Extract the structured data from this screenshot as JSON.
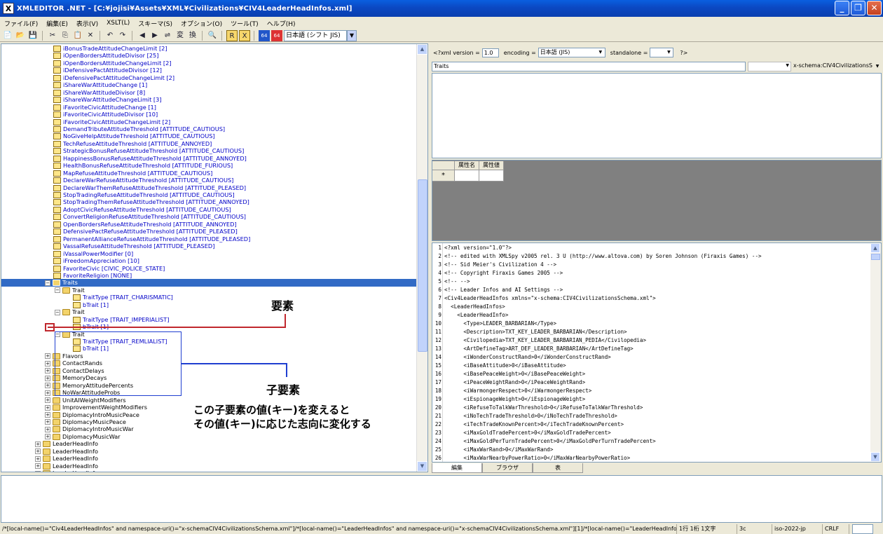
{
  "window": {
    "app_icon": "X",
    "title": "XMLEDITOR .NET - [C:¥jojisi¥Assets¥XML¥Civilizations¥CIV4LeaderHeadInfos.xml]",
    "minimize_glyph": "_",
    "maximize_glyph": "❐",
    "close_glyph": "✕"
  },
  "menu": {
    "items": [
      "ファイル(F)",
      "編集(E)",
      "表示(V)",
      "XSLT(L)",
      "スキーマ(S)",
      "オプション(O)",
      "ツール(T)",
      "ヘルプ(H)"
    ]
  },
  "toolbar": {
    "icons": [
      "new-file",
      "open-folder",
      "save",
      "cut",
      "copy",
      "paste",
      "delete",
      "undo",
      "redo",
      "find-prev",
      "find-next",
      "replace",
      "convert",
      "transform",
      "binoculars",
      "r-tool",
      "x-tool",
      "encode-64",
      "decode-64"
    ],
    "glyphs": [
      "📄",
      "📂",
      "💾",
      "✂",
      "⎘",
      "📋",
      "✕",
      "↶",
      "↷",
      "◀",
      "▶",
      "⇌",
      "変",
      "換",
      "🔍",
      "R",
      "X",
      "64",
      "64"
    ],
    "language_label": "日本語 (シフト JIS)",
    "dropdown_glyph": "▼"
  },
  "tree": {
    "rows": [
      {
        "text": "iBonusTradeAttitudeChangeLimit  [2]",
        "type": "leaf"
      },
      {
        "text": "iOpenBordersAttitudeDivisor  [25]",
        "type": "leaf"
      },
      {
        "text": "iOpenBordersAttitudeChangeLimit  [2]",
        "type": "leaf"
      },
      {
        "text": "iDefensivePactAttitudeDivisor  [12]",
        "type": "leaf"
      },
      {
        "text": "iDefensivePactAttitudeChangeLimit  [2]",
        "type": "leaf"
      },
      {
        "text": "iShareWarAttitudeChange  [1]",
        "type": "leaf"
      },
      {
        "text": "iShareWarAttitudeDivisor  [8]",
        "type": "leaf"
      },
      {
        "text": "iShareWarAttitudeChangeLimit  [3]",
        "type": "leaf"
      },
      {
        "text": "iFavoriteCivicAttitudeChange  [1]",
        "type": "leaf"
      },
      {
        "text": "iFavoriteCivicAttitudeDivisor  [10]",
        "type": "leaf"
      },
      {
        "text": "iFavoriteCivicAttitudeChangeLimit  [2]",
        "type": "leaf"
      },
      {
        "text": "DemandTributeAttitudeThreshold  [ATTITUDE_CAUTIOUS]",
        "type": "leaf"
      },
      {
        "text": "NoGiveHelpAttitudeThreshold  [ATTITUDE_CAUTIOUS]",
        "type": "leaf"
      },
      {
        "text": "TechRefuseAttitudeThreshold  [ATTITUDE_ANNOYED]",
        "type": "leaf"
      },
      {
        "text": "StrategicBonusRefuseAttitudeThreshold  [ATTITUDE_CAUTIOUS]",
        "type": "leaf"
      },
      {
        "text": "HappinessBonusRefuseAttitudeThreshold  [ATTITUDE_ANNOYED]",
        "type": "leaf"
      },
      {
        "text": "HealthBonusRefuseAttitudeThreshold  [ATTITUDE_FURIOUS]",
        "type": "leaf"
      },
      {
        "text": "MapRefuseAttitudeThreshold  [ATTITUDE_CAUTIOUS]",
        "type": "leaf"
      },
      {
        "text": "DeclareWarRefuseAttitudeThreshold  [ATTITUDE_CAUTIOUS]",
        "type": "leaf"
      },
      {
        "text": "DeclareWarThemRefuseAttitudeThreshold  [ATTITUDE_PLEASED]",
        "type": "leaf"
      },
      {
        "text": "StopTradingRefuseAttitudeThreshold  [ATTITUDE_CAUTIOUS]",
        "type": "leaf"
      },
      {
        "text": "StopTradingThemRefuseAttitudeThreshold  [ATTITUDE_ANNOYED]",
        "type": "leaf"
      },
      {
        "text": "AdoptCivicRefuseAttitudeThreshold  [ATTITUDE_CAUTIOUS]",
        "type": "leaf"
      },
      {
        "text": "ConvertReligionRefuseAttitudeThreshold  [ATTITUDE_CAUTIOUS]",
        "type": "leaf"
      },
      {
        "text": "OpenBordersRefuseAttitudeThreshold  [ATTITUDE_ANNOYED]",
        "type": "leaf"
      },
      {
        "text": "DefensivePactRefuseAttitudeThreshold  [ATTITUDE_PLEASED]",
        "type": "leaf"
      },
      {
        "text": "PermanentAllianceRefuseAttitudeThreshold  [ATTITUDE_PLEASED]",
        "type": "leaf"
      },
      {
        "text": "VassalRefuseAttitudeThreshold  [ATTITUDE_PLEASED]",
        "type": "leaf"
      },
      {
        "text": "iVassalPowerModifier  [0]",
        "type": "leaf"
      },
      {
        "text": "iFreedomAppreciation  [10]",
        "type": "leaf"
      },
      {
        "text": "FavoriteCivic  [CIVIC_POLICE_STATE]",
        "type": "leaf"
      },
      {
        "text": "FavoriteReligion  [NONE]",
        "type": "leaf"
      },
      {
        "text": "Traits",
        "type": "selected",
        "exp": "−"
      },
      {
        "text": "Trait",
        "type": "node",
        "exp": "−"
      },
      {
        "text": "TraitType  [TRAIT_CHARISMATIC]",
        "type": "leaf"
      },
      {
        "text": "bTrait  [1]",
        "type": "leaf"
      },
      {
        "text": "Trait",
        "type": "node",
        "exp": "−"
      },
      {
        "text": "TraitType  [TRAIT_IMPERIALIST]",
        "type": "leaf"
      },
      {
        "text": "bTrait  [1]",
        "type": "leaf"
      },
      {
        "text": "Trait",
        "type": "node",
        "exp": "−"
      },
      {
        "text": "TraitType  [TRAIT_REMLIALIST]",
        "type": "leaf"
      },
      {
        "text": "bTrait  [1]",
        "type": "leaf"
      },
      {
        "text": "Flavors",
        "type": "node",
        "exp": "+"
      },
      {
        "text": "ContactRands",
        "type": "node",
        "exp": "+"
      },
      {
        "text": "ContactDelays",
        "type": "node",
        "exp": "+"
      },
      {
        "text": "MemoryDecays",
        "type": "node",
        "exp": "+"
      },
      {
        "text": "MemoryAttitudePercents",
        "type": "node",
        "exp": "+"
      },
      {
        "text": "NoWarAttitudeProbs",
        "type": "node",
        "exp": "+"
      },
      {
        "text": "UnitAIWeightModifiers",
        "type": "node",
        "exp": "+"
      },
      {
        "text": "ImprovementWeightModifiers",
        "type": "node",
        "exp": "+"
      },
      {
        "text": "DiplomacyIntroMusicPeace",
        "type": "node",
        "exp": "+"
      },
      {
        "text": "DiplomacyMusicPeace",
        "type": "node",
        "exp": "+"
      },
      {
        "text": "DiplomacyIntroMusicWar",
        "type": "node",
        "exp": "+"
      },
      {
        "text": "DiplomacyMusicWar",
        "type": "node",
        "exp": "+"
      },
      {
        "text": "LeaderHeadInfo",
        "type": "node",
        "exp": "+"
      },
      {
        "text": "LeaderHeadInfo",
        "type": "node",
        "exp": "+"
      },
      {
        "text": "LeaderHeadInfo",
        "type": "node",
        "exp": "+"
      },
      {
        "text": "LeaderHeadInfo",
        "type": "node",
        "exp": "+"
      },
      {
        "text": "LeaderHeadInfo",
        "type": "node",
        "exp": "+"
      }
    ],
    "scroll_up": "▲",
    "scroll_down": "▼"
  },
  "annotations": {
    "element_label": "要素",
    "child_label": "子要素",
    "note_line1": "この子要素の値(キー)を変えると",
    "note_line2": "その値(キー)に応じた志向に変化する",
    "line_colors": {
      "element": "#c0272d",
      "child": "#1f3fd0"
    }
  },
  "declaration": {
    "xml_version_label": "<?xml version =",
    "xml_version_value": "1.0",
    "encoding_label": "encoding =",
    "encoding_value": "日本語 (JIS)",
    "standalone_label": "standalone =",
    "standalone_value": "",
    "end": "?>",
    "dropdown_glyph": "▼"
  },
  "element_editor": {
    "name_value": "Traits",
    "namespace_value": "",
    "schema_value": "x-schema:CIV4CivilizationsS"
  },
  "attributes": {
    "col_name": "属性名",
    "col_value": "属性値",
    "new_row_marker": "*"
  },
  "code": {
    "lines": [
      "<?xml version=\"1.0\"?>",
      "<!-- edited with XMLSpy v2005 rel. 3 U (http://www.altova.com) by Soren Johnson (Firaxis Games) -->",
      "<!-- Sid Meier's Civilization 4 -->",
      "<!-- Copyright Firaxis Games 2005 -->",
      "<!-- -->",
      "<!-- Leader Infos and AI Settings -->",
      "<Civ4LeaderHeadInfos xmlns=\"x-schema:CIV4CivilizationsSchema.xml\">",
      "  <LeaderHeadInfos>",
      "    <LeaderHeadInfo>",
      "      <Type>LEADER_BARBARIAN</Type>",
      "      <Description>TXT_KEY_LEADER_BARBARIAN</Description>",
      "      <Civilopedia>TXT_KEY_LEADER_BARBARIAN_PEDIA</Civilopedia>",
      "      <ArtDefineTag>ART_DEF_LEADER_BARBARIAN</ArtDefineTag>",
      "      <iWonderConstructRand>0</iWonderConstructRand>",
      "      <iBaseAttitude>0</iBaseAttitude>",
      "      <iBasePeaceWeight>0</iBasePeaceWeight>",
      "      <iPeaceWeightRand>0</iPeaceWeightRand>",
      "      <iWarmongerRespect>0</iWarmongerRespect>",
      "      <iEspionageWeight>0</iEspionageWeight>",
      "      <iRefuseToTalkWarThreshold>0</iRefuseToTalkWarThreshold>",
      "      <iNoTechTradeThreshold>0</iNoTechTradeThreshold>",
      "      <iTechTradeKnownPercent>0</iTechTradeKnownPercent>",
      "      <iMaxGoldTradePercent>0</iMaxGoldTradePercent>",
      "      <iMaxGoldPerTurnTradePercent>0</iMaxGoldPerTurnTradePercent>",
      "      <iMaxWarRand>0</iMaxWarRand>",
      "      <iMaxWarNearbyPowerRatio>0</iMaxWarNearbyPowerRatio>"
    ],
    "scroll_up": "▲",
    "scroll_down": "▼"
  },
  "tabs": [
    "編集",
    "ブラウザ",
    "表"
  ],
  "status": {
    "xpath": "/*[local-name()=\"Civ4LeaderHeadInfos\" and namespace-uri()=\"x-schemaCIV4CivilizationsSchema.xml\"]/*[local-name()=\"LeaderHeadInfos\" and namespace-uri()=\"x-schemaCIV4CivilizationsSchema.xml\"][1]/*[local-name()=\"LeaderHeadInfo\"",
    "position": "1行 1桁 1文字",
    "hex": "3c",
    "encoding": "iso-2022-jp",
    "line_end": "CRLF",
    "extra": ""
  }
}
